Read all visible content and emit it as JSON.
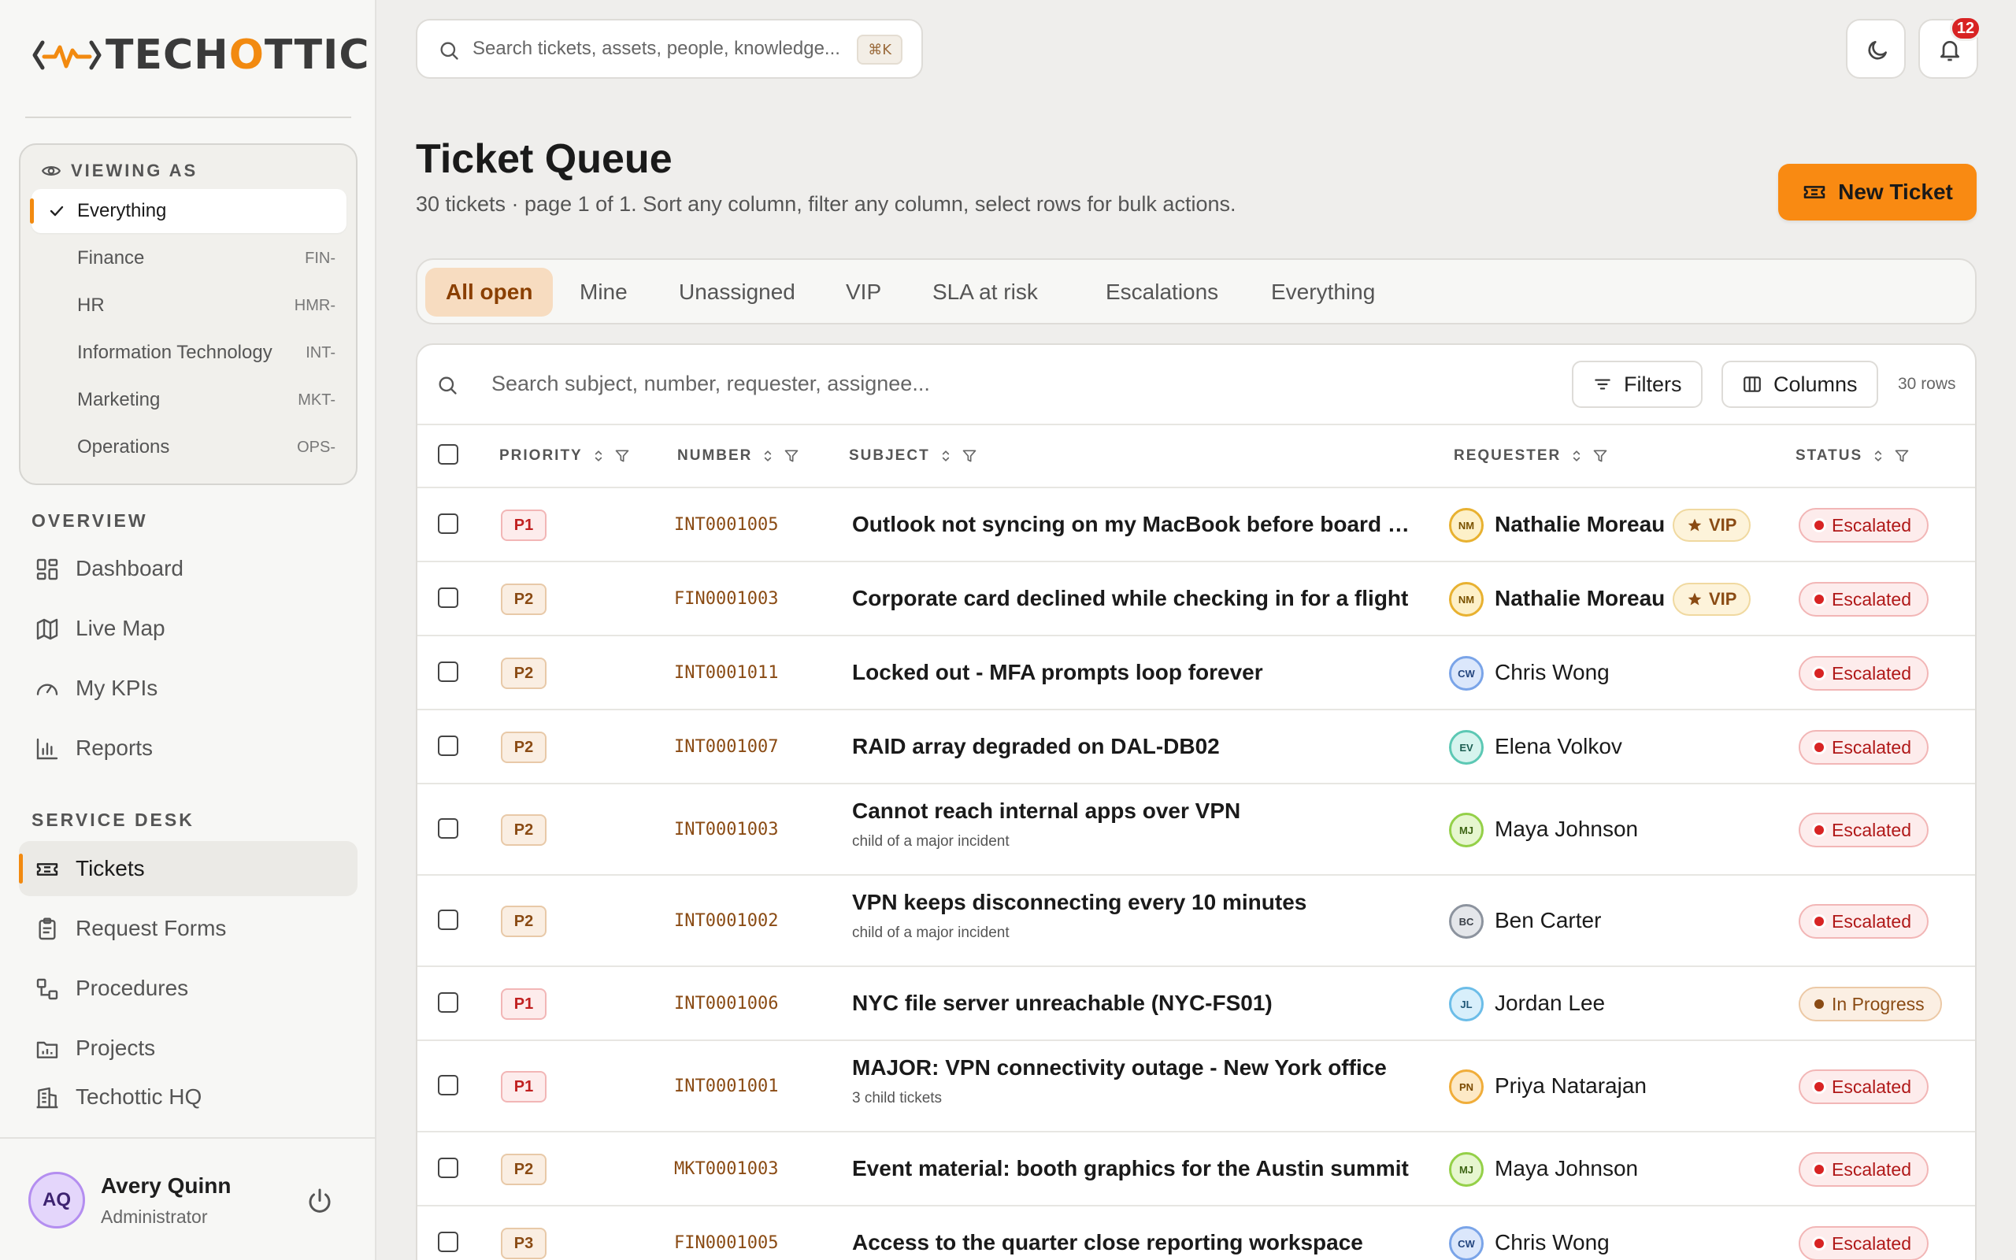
{
  "brand": {
    "text_left": "TECH",
    "text_accent": "O",
    "text_right": "TTIC"
  },
  "viewing_as": {
    "label": "VIEWING AS",
    "items": [
      {
        "label": "Everything",
        "code": "",
        "selected": true
      },
      {
        "label": "Finance",
        "code": "FIN-"
      },
      {
        "label": "HR",
        "code": "HMR-"
      },
      {
        "label": "Information Technology",
        "code": "INT-"
      },
      {
        "label": "Marketing",
        "code": "MKT-"
      },
      {
        "label": "Operations",
        "code": "OPS-"
      }
    ]
  },
  "nav": {
    "overview_label": "OVERVIEW",
    "overview": [
      {
        "label": "Dashboard",
        "icon": "dashboard-icon"
      },
      {
        "label": "Live Map",
        "icon": "map-icon"
      },
      {
        "label": "My KPIs",
        "icon": "gauge-icon"
      },
      {
        "label": "Reports",
        "icon": "bar-chart-icon"
      }
    ],
    "service_label": "SERVICE DESK",
    "service": [
      {
        "label": "Tickets",
        "icon": "ticket-icon",
        "active": true
      },
      {
        "label": "Request Forms",
        "icon": "clipboard-icon"
      },
      {
        "label": "Procedures",
        "icon": "workflow-icon"
      },
      {
        "label": "Projects",
        "icon": "folder-chart-icon"
      },
      {
        "label": "Techottic HQ",
        "icon": "building-icon"
      }
    ]
  },
  "user": {
    "initials": "AQ",
    "name": "Avery Quinn",
    "role": "Administrator"
  },
  "topbar": {
    "search_placeholder": "Search tickets, assets, people, knowledge...",
    "shortcut": "⌘K",
    "notifications": "12"
  },
  "page": {
    "title": "Ticket Queue",
    "subtitle": "30 tickets · page 1 of 1. Sort any column, filter any column, select rows for bulk actions.",
    "new_ticket": "New Ticket"
  },
  "tabs": [
    "All open",
    "Mine",
    "Unassigned",
    "VIP",
    "SLA at risk",
    "Escalations",
    "Everything"
  ],
  "table": {
    "search_placeholder": "Search subject, number, requester, assignee...",
    "filters_label": "Filters",
    "columns_label": "Columns",
    "row_count": "30 rows",
    "headers": {
      "priority": "PRIORITY",
      "number": "NUMBER",
      "subject": "SUBJECT",
      "requester": "REQUESTER",
      "status": "STATUS"
    },
    "vip_label": "VIP",
    "rows": [
      {
        "priority": "P1",
        "number": "INT0001005",
        "subject": "Outlook not syncing on my MacBook before board m…",
        "sub": "",
        "initials": "NM",
        "requester": "Nathalie Moreau",
        "vip": true,
        "status": "Escalated"
      },
      {
        "priority": "P2",
        "number": "FIN0001003",
        "subject": "Corporate card declined while checking in for a flight",
        "sub": "",
        "initials": "NM",
        "requester": "Nathalie Moreau",
        "vip": true,
        "status": "Escalated"
      },
      {
        "priority": "P2",
        "number": "INT0001011",
        "subject": "Locked out - MFA prompts loop forever",
        "sub": "",
        "initials": "CW",
        "requester": "Chris Wong",
        "vip": false,
        "status": "Escalated"
      },
      {
        "priority": "P2",
        "number": "INT0001007",
        "subject": "RAID array degraded on DAL-DB02",
        "sub": "",
        "initials": "EV",
        "requester": "Elena Volkov",
        "vip": false,
        "status": "Escalated"
      },
      {
        "priority": "P2",
        "number": "INT0001003",
        "subject": "Cannot reach internal apps over VPN",
        "sub": "child of a major incident",
        "initials": "MJ",
        "requester": "Maya Johnson",
        "vip": false,
        "status": "Escalated"
      },
      {
        "priority": "P2",
        "number": "INT0001002",
        "subject": "VPN keeps disconnecting every 10 minutes",
        "sub": "child of a major incident",
        "initials": "BC",
        "requester": "Ben Carter",
        "vip": false,
        "status": "Escalated"
      },
      {
        "priority": "P1",
        "number": "INT0001006",
        "subject": "NYC file server unreachable (NYC-FS01)",
        "sub": "",
        "initials": "JL",
        "requester": "Jordan Lee",
        "vip": false,
        "status": "In Progress"
      },
      {
        "priority": "P1",
        "number": "INT0001001",
        "subject": "MAJOR: VPN connectivity outage - New York office",
        "sub": "3 child tickets",
        "initials": "PN",
        "requester": "Priya Natarajan",
        "vip": false,
        "status": "Escalated"
      },
      {
        "priority": "P2",
        "number": "MKT0001003",
        "subject": "Event material: booth graphics for the Austin summit",
        "sub": "",
        "initials": "MJ",
        "requester": "Maya Johnson",
        "vip": false,
        "status": "Escalated"
      },
      {
        "priority": "P3",
        "number": "FIN0001005",
        "subject": "Access to the quarter close reporting workspace",
        "sub": "",
        "initials": "CW",
        "requester": "Chris Wong",
        "vip": false,
        "status": "Escalated"
      }
    ]
  },
  "colors": {
    "accent": "#f98a12",
    "escalated": "#d82323",
    "in_progress": "#8a4b14"
  }
}
